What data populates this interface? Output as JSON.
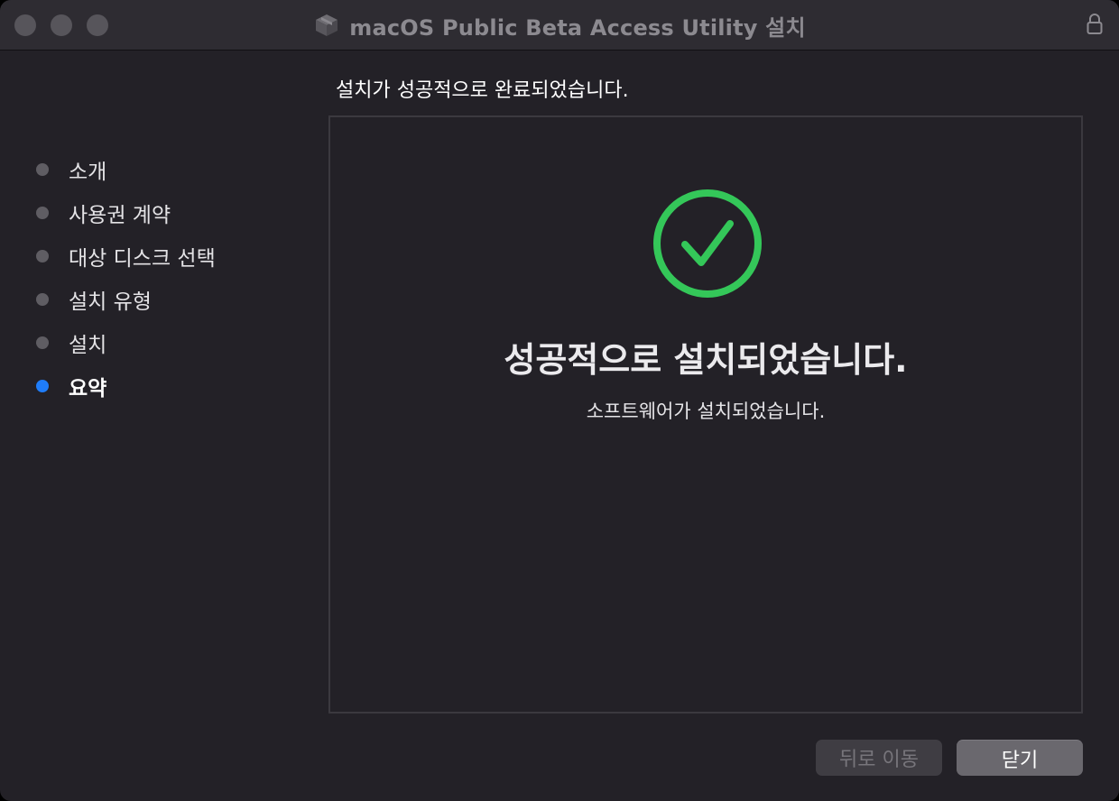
{
  "window": {
    "title": "macOS Public Beta Access Utility 설치",
    "controls": {
      "close": "close-button",
      "minimize": "minimize-button",
      "zoom": "zoom-button"
    },
    "title_icon": "package-icon",
    "lock_icon": "lock-icon"
  },
  "sidebar": {
    "steps": [
      {
        "label": "소개",
        "active": false
      },
      {
        "label": "사용권 계약",
        "active": false
      },
      {
        "label": "대상 디스크 선택",
        "active": false
      },
      {
        "label": "설치 유형",
        "active": false
      },
      {
        "label": "설치",
        "active": false
      },
      {
        "label": "요약",
        "active": true
      }
    ]
  },
  "main": {
    "heading": "설치가 성공적으로 완료되었습니다.",
    "status_icon": "checkmark-circle-icon",
    "success_title": "성공적으로 설치되었습니다.",
    "success_subtitle": "소프트웨어가 설치되었습니다."
  },
  "footer": {
    "back_label": "뒤로 이동",
    "close_label": "닫기"
  },
  "colors": {
    "accent": "#1f7dfa",
    "success": "#34c759",
    "window_bg": "#232127"
  }
}
